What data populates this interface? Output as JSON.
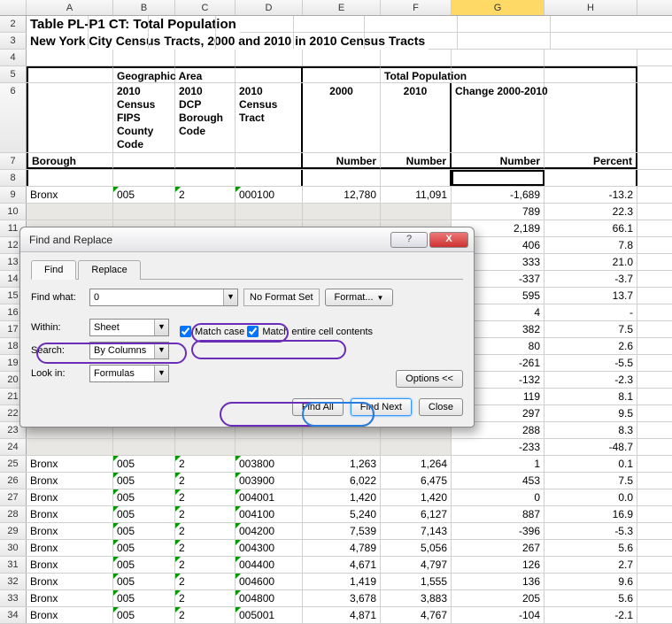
{
  "columns": [
    "A",
    "B",
    "C",
    "D",
    "E",
    "F",
    "G",
    "H"
  ],
  "selected_col": "G",
  "title_rows": {
    "r2": "Table PL-P1 CT:  Total Population",
    "r3": "New York City Census Tracts, 2000 and 2010 in 2010 Census Tracts"
  },
  "headers": {
    "geo_area": "Geographic Area",
    "total_pop": "Total Population",
    "borough": "Borough",
    "fips": "2010 Census FIPS County Code",
    "dcp": "2010 DCP Borough Code",
    "tract": "2010 Census Tract",
    "y2000": "2000",
    "y2010": "2010",
    "change": "Change 2000-2010",
    "number": "Number",
    "percent": "Percent"
  },
  "row_labels": [
    "2",
    "3",
    "4",
    "5",
    "6",
    "7",
    "8",
    "9",
    "10",
    "11",
    "12",
    "13",
    "14",
    "15",
    "16",
    "17",
    "18",
    "19",
    "20",
    "21",
    "22",
    "23",
    "24",
    "25",
    "26",
    "27",
    "28",
    "29",
    "30",
    "31",
    "32",
    "33",
    "34"
  ],
  "data_rows": [
    {
      "r": 9,
      "borough": "Bronx",
      "fips": "005",
      "dcp": "2",
      "tract": "000100",
      "n2000": "12,780",
      "n2010": "11,091",
      "chg": "-1,689",
      "pct": "-13.2"
    },
    {
      "r": 10,
      "chg": "789",
      "pct": "22.3"
    },
    {
      "r": 11,
      "chg": "2,189",
      "pct": "66.1"
    },
    {
      "r": 12,
      "chg": "406",
      "pct": "7.8"
    },
    {
      "r": 13,
      "chg": "333",
      "pct": "21.0"
    },
    {
      "r": 14,
      "chg": "-337",
      "pct": "-3.7"
    },
    {
      "r": 15,
      "chg": "595",
      "pct": "13.7"
    },
    {
      "r": 16,
      "chg": "4",
      "pct": "-"
    },
    {
      "r": 17,
      "chg": "382",
      "pct": "7.5"
    },
    {
      "r": 18,
      "chg": "80",
      "pct": "2.6"
    },
    {
      "r": 19,
      "chg": "-261",
      "pct": "-5.5"
    },
    {
      "r": 20,
      "chg": "-132",
      "pct": "-2.3"
    },
    {
      "r": 21,
      "chg": "119",
      "pct": "8.1"
    },
    {
      "r": 22,
      "chg": "297",
      "pct": "9.5"
    },
    {
      "r": 23,
      "chg": "288",
      "pct": "8.3"
    },
    {
      "r": 24,
      "chg": "-233",
      "pct": "-48.7"
    },
    {
      "r": 25,
      "borough": "Bronx",
      "fips": "005",
      "dcp": "2",
      "tract": "003800",
      "n2000": "1,263",
      "n2010": "1,264",
      "chg": "1",
      "pct": "0.1"
    },
    {
      "r": 26,
      "borough": "Bronx",
      "fips": "005",
      "dcp": "2",
      "tract": "003900",
      "n2000": "6,022",
      "n2010": "6,475",
      "chg": "453",
      "pct": "7.5"
    },
    {
      "r": 27,
      "borough": "Bronx",
      "fips": "005",
      "dcp": "2",
      "tract": "004001",
      "n2000": "1,420",
      "n2010": "1,420",
      "chg": "0",
      "pct": "0.0"
    },
    {
      "r": 28,
      "borough": "Bronx",
      "fips": "005",
      "dcp": "2",
      "tract": "004100",
      "n2000": "5,240",
      "n2010": "6,127",
      "chg": "887",
      "pct": "16.9"
    },
    {
      "r": 29,
      "borough": "Bronx",
      "fips": "005",
      "dcp": "2",
      "tract": "004200",
      "n2000": "7,539",
      "n2010": "7,143",
      "chg": "-396",
      "pct": "-5.3"
    },
    {
      "r": 30,
      "borough": "Bronx",
      "fips": "005",
      "dcp": "2",
      "tract": "004300",
      "n2000": "4,789",
      "n2010": "5,056",
      "chg": "267",
      "pct": "5.6"
    },
    {
      "r": 31,
      "borough": "Bronx",
      "fips": "005",
      "dcp": "2",
      "tract": "004400",
      "n2000": "4,671",
      "n2010": "4,797",
      "chg": "126",
      "pct": "2.7"
    },
    {
      "r": 32,
      "borough": "Bronx",
      "fips": "005",
      "dcp": "2",
      "tract": "004600",
      "n2000": "1,419",
      "n2010": "1,555",
      "chg": "136",
      "pct": "9.6"
    },
    {
      "r": 33,
      "borough": "Bronx",
      "fips": "005",
      "dcp": "2",
      "tract": "004800",
      "n2000": "3,678",
      "n2010": "3,883",
      "chg": "205",
      "pct": "5.6"
    },
    {
      "r": 34,
      "borough": "Bronx",
      "fips": "005",
      "dcp": "2",
      "tract": "005001",
      "n2000": "4,871",
      "n2010": "4,767",
      "chg": "-104",
      "pct": "-2.1"
    }
  ],
  "dialog": {
    "title": "Find and Replace",
    "tabs": {
      "find": "Find",
      "replace": "Replace"
    },
    "find_what_label": "Find what:",
    "find_what_value": "0",
    "no_format": "No Format Set",
    "format_btn": "Format...",
    "within_label": "Within:",
    "within_value": "Sheet",
    "search_label": "Search:",
    "search_value": "By Columns",
    "lookin_label": "Look in:",
    "lookin_value": "Formulas",
    "match_case": "Match case",
    "match_entire": "Match entire cell contents",
    "options_btn": "Options <<",
    "find_all": "Find All",
    "find_next": "Find Next",
    "close": "Close"
  }
}
